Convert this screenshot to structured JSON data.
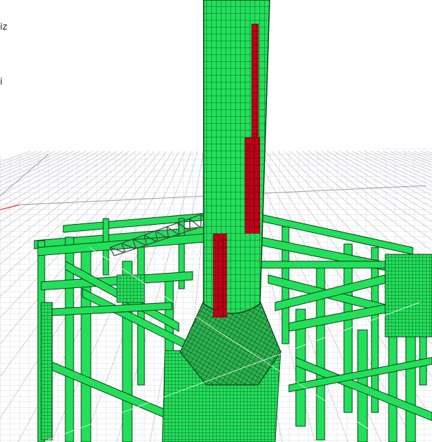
{
  "viewport": {
    "overlay_labels": [
      "iz",
      "i"
    ]
  },
  "colors": {
    "background": "#ffffff",
    "grid": "#c8c8d2",
    "frame_fill": "#22e05a",
    "frame_edge": "#0a3a14",
    "highlight_panel": "#c0001a",
    "x_axis": "#e03030",
    "truss": "#444444",
    "diagonal_guides": "#d8d8d8"
  },
  "icons": [
    "chimney-model",
    "grid-plane",
    "axis-x"
  ]
}
